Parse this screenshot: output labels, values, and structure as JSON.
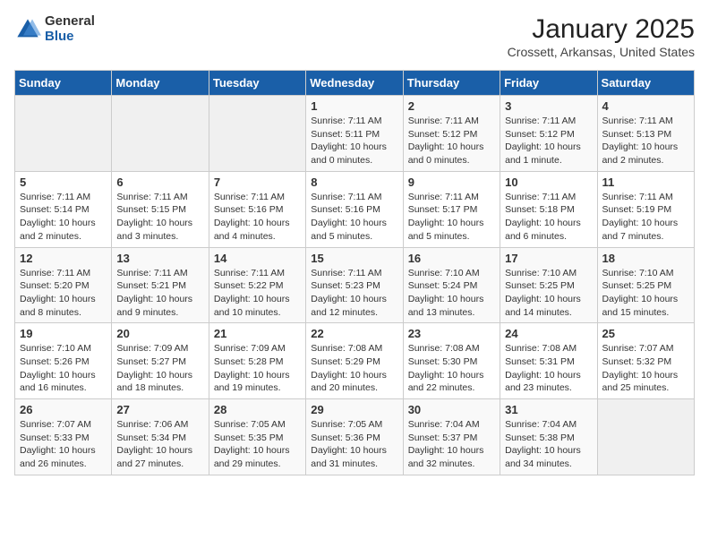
{
  "header": {
    "logo_general": "General",
    "logo_blue": "Blue",
    "title": "January 2025",
    "subtitle": "Crossett, Arkansas, United States"
  },
  "weekdays": [
    "Sunday",
    "Monday",
    "Tuesday",
    "Wednesday",
    "Thursday",
    "Friday",
    "Saturday"
  ],
  "weeks": [
    [
      {
        "day": "",
        "sunrise": "",
        "sunset": "",
        "daylight": ""
      },
      {
        "day": "",
        "sunrise": "",
        "sunset": "",
        "daylight": ""
      },
      {
        "day": "",
        "sunrise": "",
        "sunset": "",
        "daylight": ""
      },
      {
        "day": "1",
        "sunrise": "Sunrise: 7:11 AM",
        "sunset": "Sunset: 5:11 PM",
        "daylight": "Daylight: 10 hours and 0 minutes."
      },
      {
        "day": "2",
        "sunrise": "Sunrise: 7:11 AM",
        "sunset": "Sunset: 5:12 PM",
        "daylight": "Daylight: 10 hours and 0 minutes."
      },
      {
        "day": "3",
        "sunrise": "Sunrise: 7:11 AM",
        "sunset": "Sunset: 5:12 PM",
        "daylight": "Daylight: 10 hours and 1 minute."
      },
      {
        "day": "4",
        "sunrise": "Sunrise: 7:11 AM",
        "sunset": "Sunset: 5:13 PM",
        "daylight": "Daylight: 10 hours and 2 minutes."
      }
    ],
    [
      {
        "day": "5",
        "sunrise": "Sunrise: 7:11 AM",
        "sunset": "Sunset: 5:14 PM",
        "daylight": "Daylight: 10 hours and 2 minutes."
      },
      {
        "day": "6",
        "sunrise": "Sunrise: 7:11 AM",
        "sunset": "Sunset: 5:15 PM",
        "daylight": "Daylight: 10 hours and 3 minutes."
      },
      {
        "day": "7",
        "sunrise": "Sunrise: 7:11 AM",
        "sunset": "Sunset: 5:16 PM",
        "daylight": "Daylight: 10 hours and 4 minutes."
      },
      {
        "day": "8",
        "sunrise": "Sunrise: 7:11 AM",
        "sunset": "Sunset: 5:16 PM",
        "daylight": "Daylight: 10 hours and 5 minutes."
      },
      {
        "day": "9",
        "sunrise": "Sunrise: 7:11 AM",
        "sunset": "Sunset: 5:17 PM",
        "daylight": "Daylight: 10 hours and 5 minutes."
      },
      {
        "day": "10",
        "sunrise": "Sunrise: 7:11 AM",
        "sunset": "Sunset: 5:18 PM",
        "daylight": "Daylight: 10 hours and 6 minutes."
      },
      {
        "day": "11",
        "sunrise": "Sunrise: 7:11 AM",
        "sunset": "Sunset: 5:19 PM",
        "daylight": "Daylight: 10 hours and 7 minutes."
      }
    ],
    [
      {
        "day": "12",
        "sunrise": "Sunrise: 7:11 AM",
        "sunset": "Sunset: 5:20 PM",
        "daylight": "Daylight: 10 hours and 8 minutes."
      },
      {
        "day": "13",
        "sunrise": "Sunrise: 7:11 AM",
        "sunset": "Sunset: 5:21 PM",
        "daylight": "Daylight: 10 hours and 9 minutes."
      },
      {
        "day": "14",
        "sunrise": "Sunrise: 7:11 AM",
        "sunset": "Sunset: 5:22 PM",
        "daylight": "Daylight: 10 hours and 10 minutes."
      },
      {
        "day": "15",
        "sunrise": "Sunrise: 7:11 AM",
        "sunset": "Sunset: 5:23 PM",
        "daylight": "Daylight: 10 hours and 12 minutes."
      },
      {
        "day": "16",
        "sunrise": "Sunrise: 7:10 AM",
        "sunset": "Sunset: 5:24 PM",
        "daylight": "Daylight: 10 hours and 13 minutes."
      },
      {
        "day": "17",
        "sunrise": "Sunrise: 7:10 AM",
        "sunset": "Sunset: 5:25 PM",
        "daylight": "Daylight: 10 hours and 14 minutes."
      },
      {
        "day": "18",
        "sunrise": "Sunrise: 7:10 AM",
        "sunset": "Sunset: 5:25 PM",
        "daylight": "Daylight: 10 hours and 15 minutes."
      }
    ],
    [
      {
        "day": "19",
        "sunrise": "Sunrise: 7:10 AM",
        "sunset": "Sunset: 5:26 PM",
        "daylight": "Daylight: 10 hours and 16 minutes."
      },
      {
        "day": "20",
        "sunrise": "Sunrise: 7:09 AM",
        "sunset": "Sunset: 5:27 PM",
        "daylight": "Daylight: 10 hours and 18 minutes."
      },
      {
        "day": "21",
        "sunrise": "Sunrise: 7:09 AM",
        "sunset": "Sunset: 5:28 PM",
        "daylight": "Daylight: 10 hours and 19 minutes."
      },
      {
        "day": "22",
        "sunrise": "Sunrise: 7:08 AM",
        "sunset": "Sunset: 5:29 PM",
        "daylight": "Daylight: 10 hours and 20 minutes."
      },
      {
        "day": "23",
        "sunrise": "Sunrise: 7:08 AM",
        "sunset": "Sunset: 5:30 PM",
        "daylight": "Daylight: 10 hours and 22 minutes."
      },
      {
        "day": "24",
        "sunrise": "Sunrise: 7:08 AM",
        "sunset": "Sunset: 5:31 PM",
        "daylight": "Daylight: 10 hours and 23 minutes."
      },
      {
        "day": "25",
        "sunrise": "Sunrise: 7:07 AM",
        "sunset": "Sunset: 5:32 PM",
        "daylight": "Daylight: 10 hours and 25 minutes."
      }
    ],
    [
      {
        "day": "26",
        "sunrise": "Sunrise: 7:07 AM",
        "sunset": "Sunset: 5:33 PM",
        "daylight": "Daylight: 10 hours and 26 minutes."
      },
      {
        "day": "27",
        "sunrise": "Sunrise: 7:06 AM",
        "sunset": "Sunset: 5:34 PM",
        "daylight": "Daylight: 10 hours and 27 minutes."
      },
      {
        "day": "28",
        "sunrise": "Sunrise: 7:05 AM",
        "sunset": "Sunset: 5:35 PM",
        "daylight": "Daylight: 10 hours and 29 minutes."
      },
      {
        "day": "29",
        "sunrise": "Sunrise: 7:05 AM",
        "sunset": "Sunset: 5:36 PM",
        "daylight": "Daylight: 10 hours and 31 minutes."
      },
      {
        "day": "30",
        "sunrise": "Sunrise: 7:04 AM",
        "sunset": "Sunset: 5:37 PM",
        "daylight": "Daylight: 10 hours and 32 minutes."
      },
      {
        "day": "31",
        "sunrise": "Sunrise: 7:04 AM",
        "sunset": "Sunset: 5:38 PM",
        "daylight": "Daylight: 10 hours and 34 minutes."
      },
      {
        "day": "",
        "sunrise": "",
        "sunset": "",
        "daylight": ""
      }
    ]
  ]
}
